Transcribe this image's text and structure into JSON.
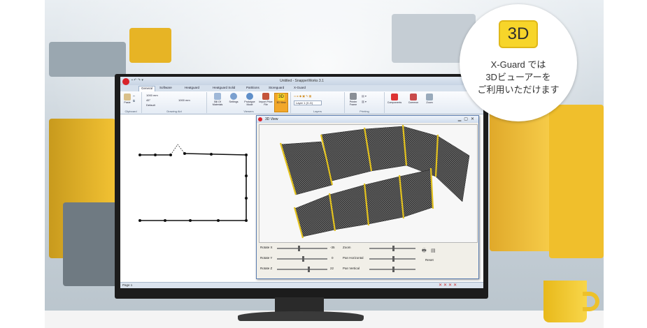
{
  "badge": {
    "icon_label": "3D",
    "line1": "X-Guard では",
    "line2": "3Dビューアーを",
    "line3": "ご利用いただけます"
  },
  "app": {
    "title": "Untitled - SnapperWorks 3.1",
    "tabs": [
      "General",
      "Software",
      "Heatguard",
      "Heatguard Solid",
      "Partitions",
      "Storeguard",
      "X-Guard"
    ],
    "ribbon_groups": {
      "clipboard": "Clipboard",
      "drawing_aid": "Drawing Aid",
      "viewers": "Viewers",
      "layers": "Layers",
      "printing": "Printing"
    },
    "ribbon_buttons": {
      "paste": "Paste",
      "bill_of_materials": "Bill Of Materials",
      "settings": "Settings",
      "prototype_mode": "Prototype Mode",
      "import_price_file": "Import Price File",
      "view_3d": "3D View",
      "view_3d_icon": "3D",
      "printer_frame": "Printer Frame",
      "components": "Components",
      "common": "Common",
      "zoom": "Zoom"
    },
    "ribbon_small": {
      "length": "1000 mm",
      "angle": "45°",
      "default": "Default",
      "width": "1000 mm",
      "layer": "Layer 1 (X-G)"
    },
    "status": "Page 1",
    "accent": "#f2a72a"
  },
  "viewer3d": {
    "title": "3D View",
    "controls": {
      "rotate_x_label": "Rotate X",
      "rotate_x_value": "-35",
      "rotate_y_label": "Rotate Y",
      "rotate_y_value": "0",
      "rotate_z_label": "Rotate Z",
      "rotate_z_value": "22",
      "zoom_label": "Zoom",
      "pan_h_label": "Pan Horizontal",
      "pan_v_label": "Pan Vertical",
      "reset_label": "Reset"
    }
  }
}
